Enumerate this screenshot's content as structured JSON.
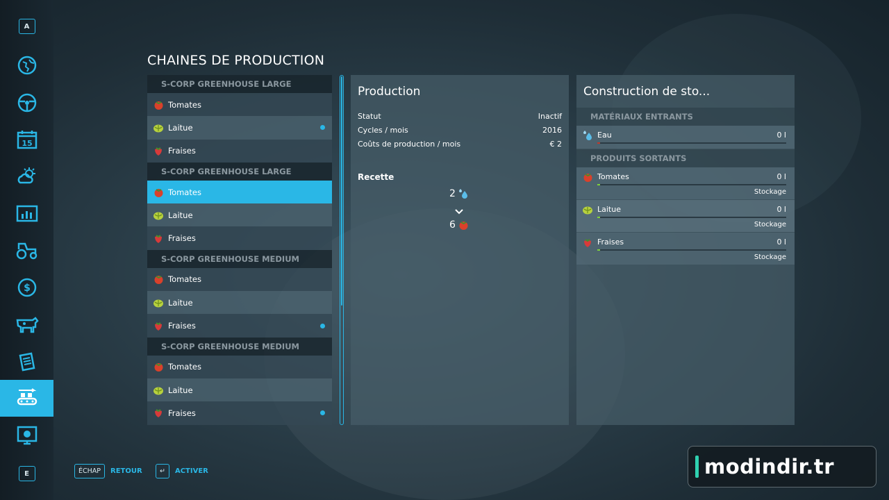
{
  "page_title": "CHAINES DE PRODUCTION",
  "sidebar": {
    "top_key": "A",
    "bottom_key": "E",
    "items": [
      {
        "icon": "globe-map-icon"
      },
      {
        "icon": "steering-wheel-icon"
      },
      {
        "icon": "calendar-icon",
        "label": "15"
      },
      {
        "icon": "weather-icon"
      },
      {
        "icon": "stats-chart-icon"
      },
      {
        "icon": "tractor-icon"
      },
      {
        "icon": "money-icon"
      },
      {
        "icon": "animals-icon"
      },
      {
        "icon": "contracts-icon"
      },
      {
        "icon": "production-icon",
        "active": true
      },
      {
        "icon": "help-icon"
      }
    ]
  },
  "production_groups": [
    {
      "title": "S-CORP GREENHOUSE LARGE",
      "items": [
        {
          "name": "Tomates",
          "icon": "tomato-icon",
          "dot": false
        },
        {
          "name": "Laitue",
          "icon": "lettuce-icon",
          "dot": true
        },
        {
          "name": "Fraises",
          "icon": "strawberry-icon",
          "dot": false
        }
      ]
    },
    {
      "title": "S-CORP GREENHOUSE LARGE",
      "items": [
        {
          "name": "Tomates",
          "icon": "tomato-icon",
          "dot": false,
          "selected": true
        },
        {
          "name": "Laitue",
          "icon": "lettuce-icon",
          "dot": false
        },
        {
          "name": "Fraises",
          "icon": "strawberry-icon",
          "dot": false
        }
      ]
    },
    {
      "title": "S-CORP GREENHOUSE MEDIUM",
      "items": [
        {
          "name": "Tomates",
          "icon": "tomato-icon",
          "dot": false
        },
        {
          "name": "Laitue",
          "icon": "lettuce-icon",
          "dot": false
        },
        {
          "name": "Fraises",
          "icon": "strawberry-icon",
          "dot": true
        }
      ]
    },
    {
      "title": "S-CORP GREENHOUSE MEDIUM",
      "items": [
        {
          "name": "Tomates",
          "icon": "tomato-icon",
          "dot": false
        },
        {
          "name": "Laitue",
          "icon": "lettuce-icon",
          "dot": false
        },
        {
          "name": "Fraises",
          "icon": "strawberry-icon",
          "dot": true
        }
      ]
    }
  ],
  "production_panel": {
    "title": "Production",
    "stats": [
      {
        "label": "Statut",
        "value": "Inactif"
      },
      {
        "label": "Cycles / mois",
        "value": "2016"
      },
      {
        "label": "Coûts de production / mois",
        "value": "€ 2"
      }
    ],
    "recipe_label": "Recette",
    "recipe_input_qty": "2",
    "recipe_input_icon": "water-drops-icon",
    "recipe_output_qty": "6",
    "recipe_output_icon": "tomato-icon"
  },
  "storage_panel": {
    "title": "Construction de sto...",
    "inputs_header": "MATÉRIAUX ENTRANTS",
    "inputs": [
      {
        "name": "Eau",
        "value": "0 l",
        "icon": "water-drops-icon",
        "fill_fraction": 0
      }
    ],
    "outputs_header": "PRODUITS SORTANTS",
    "outputs": [
      {
        "name": "Tomates",
        "value": "0 l",
        "mode": "Stockage",
        "icon": "tomato-icon",
        "fill_fraction": 0
      },
      {
        "name": "Laitue",
        "value": "0 l",
        "mode": "Stockage",
        "icon": "lettuce-icon",
        "fill_fraction": 0
      },
      {
        "name": "Fraises",
        "value": "0 l",
        "mode": "Stockage",
        "icon": "strawberry-icon",
        "fill_fraction": 0
      }
    ]
  },
  "footer": {
    "back_key": "ÉCHAP",
    "back_label": "RETOUR",
    "activate_key": "↵",
    "activate_label": "ACTIVER"
  },
  "watermark": "modindir.tr",
  "colors": {
    "accent": "#2ab7e6",
    "input_bar_empty": "#c0392b",
    "output_bar_empty": "#7fd13b"
  }
}
